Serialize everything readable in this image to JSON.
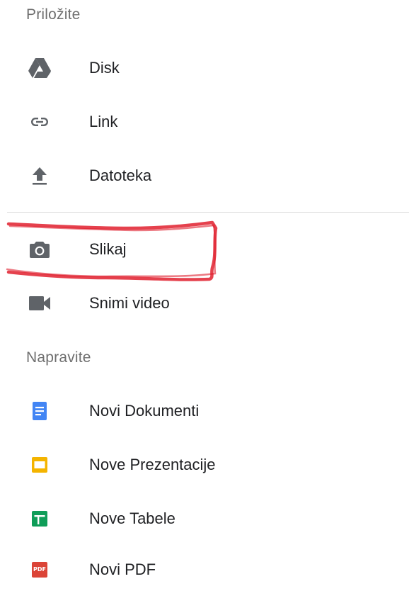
{
  "attach": {
    "header": "Priložite",
    "items": [
      {
        "label": "Disk",
        "icon": "drive-icon"
      },
      {
        "label": "Link",
        "icon": "link-icon"
      },
      {
        "label": "Datoteka",
        "icon": "upload-icon"
      },
      {
        "label": "Slikaj",
        "icon": "camera-icon"
      },
      {
        "label": "Snimi video",
        "icon": "videocam-icon"
      }
    ]
  },
  "create": {
    "header": "Napravite",
    "items": [
      {
        "label": "Novi Dokumenti",
        "icon": "docs-icon"
      },
      {
        "label": "Nove Prezentacije",
        "icon": "slides-icon"
      },
      {
        "label": "Nove Tabele",
        "icon": "sheets-icon"
      },
      {
        "label": "Novi PDF",
        "icon": "pdf-icon",
        "badge": "PDF"
      }
    ]
  },
  "colors": {
    "docs": "#4285f4",
    "slides": "#f4b400",
    "sheets": "#0f9d58",
    "pdf": "#db4437",
    "icon_gray": "#5f6368",
    "annotation_red": "#e0202e"
  }
}
